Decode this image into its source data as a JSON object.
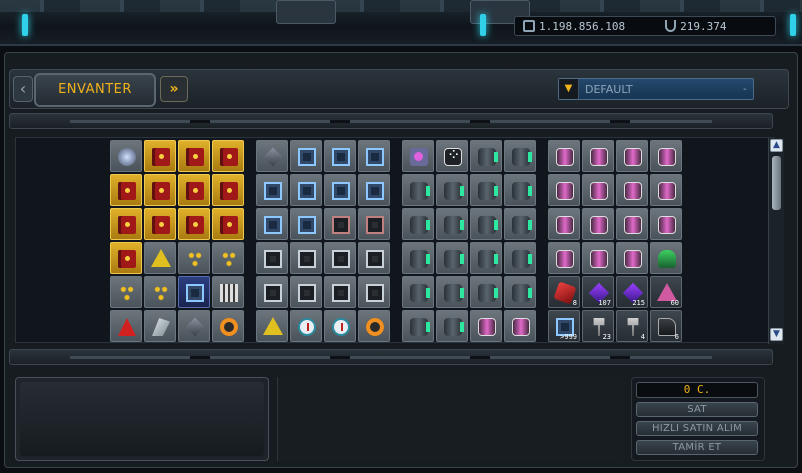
{
  "currency": {
    "credits": "1.198.856.108",
    "uridium": "219.374"
  },
  "header": {
    "tab_label": "ENVANTER",
    "nav_prev": "‹",
    "nav_next": "»",
    "sort_value": "DEFAULT",
    "sort_arrow": "▼",
    "sort_dash": "-"
  },
  "inventory": {
    "groups": [
      {
        "name": "group-1",
        "rows": [
          [
            "orb",
            "book",
            "book",
            "book"
          ],
          [
            "book",
            "book",
            "book",
            "book"
          ],
          [
            "book",
            "book",
            "book",
            "book"
          ],
          [
            "book",
            "tri",
            "dots",
            "dots"
          ],
          [
            "dots",
            "dots",
            "chip",
            "cards"
          ],
          [
            "redA",
            "wing",
            "cube",
            "gear"
          ]
        ]
      },
      {
        "name": "group-2",
        "rows": [
          [
            "cube",
            "chip",
            "chip",
            "chip"
          ],
          [
            "chip",
            "chip",
            "chip",
            "chip"
          ],
          [
            "chip",
            "chip",
            "frame",
            "frame"
          ],
          [
            "frame",
            "frame",
            "frame",
            "frame"
          ],
          [
            "frame",
            "frame",
            "frame",
            "frame"
          ],
          [
            "tri",
            "gauge",
            "gauge",
            "mech"
          ]
        ]
      },
      {
        "name": "group-3",
        "rows": [
          [
            "camera",
            "dice",
            "barrel",
            "barrel"
          ],
          [
            "barrel",
            "barrel",
            "barrel",
            "barrel"
          ],
          [
            "barrel",
            "barrel",
            "barrel",
            "barrel"
          ],
          [
            "barrel",
            "barrel",
            "barrel",
            "barrel"
          ],
          [
            "barrel",
            "barrel",
            "barrel",
            "barrel"
          ],
          [
            "barrel",
            "barrel",
            "pink",
            "pink"
          ]
        ]
      },
      {
        "name": "group-4",
        "rows": [
          [
            "pink",
            "pink",
            "pink",
            "pink"
          ],
          [
            "pink",
            "pink",
            "pink",
            "pink"
          ],
          [
            "pink",
            "pink",
            "pink",
            "pink"
          ],
          [
            "pink",
            "pink",
            "pink",
            "lamp"
          ],
          [
            "redgem",
            "crystal",
            "crystal",
            "pyramid"
          ],
          [
            "chip",
            "tool",
            "tool",
            "bag"
          ]
        ]
      }
    ],
    "quantities": {
      "g4_r4_c0": "8",
      "g4_r4_c1": "107",
      "g4_r4_c2": "215",
      "g4_r4_c3": "60",
      "g4_r5_c0": ">999",
      "g4_r5_c1": "23",
      "g4_r5_c2": "4",
      "g4_r5_c3": "6"
    }
  },
  "scrollbar": {
    "up": "▲",
    "down": "▼"
  },
  "actions": {
    "price": "0 C.",
    "sell": "SAT",
    "quick_buy": "HIZLI SATIN ALIM",
    "repair": "TAMİR ET"
  }
}
